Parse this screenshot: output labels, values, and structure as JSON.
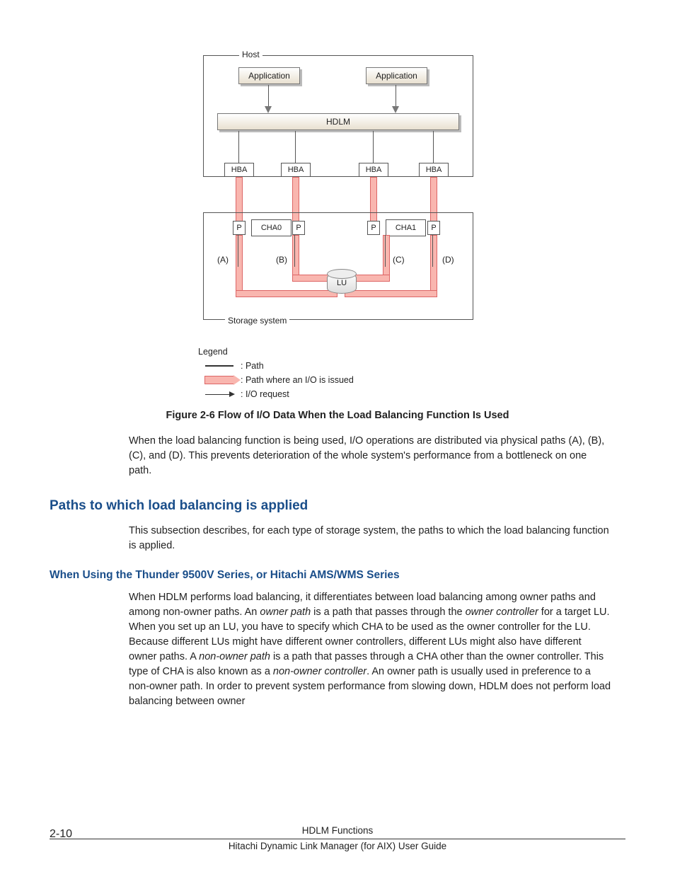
{
  "diagram": {
    "host_label": "Host",
    "app1": "Application",
    "app2": "Application",
    "hdlm": "HDLM",
    "hba": "HBA",
    "storage_label": "Storage system",
    "p": "P",
    "cha0": "CHA0",
    "cha1": "CHA1",
    "lu": "LU",
    "letters": {
      "a": "(A)",
      "b": "(B)",
      "c": "(C)",
      "d": "(D)"
    }
  },
  "legend": {
    "title": "Legend",
    "path": ": Path",
    "pink": ": Path where an I/O is issued",
    "arrow": ": I/O request"
  },
  "caption": "Figure 2-6 Flow of I/O Data When the Load Balancing Function Is Used",
  "para1": "When the load balancing function is being used, I/O operations are distributed via physical paths (A), (B), (C), and (D). This prevents deterioration of the whole system's performance from a bottleneck on one path.",
  "h2": "Paths to which load balancing is applied",
  "para2": "This subsection describes, for each type of storage system, the paths to which the load balancing function is applied.",
  "h3": "When Using the Thunder 9500V Series, or Hitachi AMS/WMS Series",
  "para3_parts": {
    "t1": "When HDLM performs load balancing, it differentiates between load balancing among owner paths and among non-owner paths. An ",
    "e1": "owner path",
    "t2": " is a path that passes through the ",
    "e2": "owner controller",
    "t3": " for a target LU. When you set up an LU, you have to specify which CHA to be used as the owner controller for the LU. Because different LUs might have different owner controllers, different LUs might also have different owner paths. A ",
    "e3": "non-owner path",
    "t4": " is a path that passes through a CHA other than the owner controller. This type of CHA is also known as a ",
    "e4": "non-owner controller",
    "t5": ". An owner path is usually used in preference to a non-owner path. In order to prevent system performance from slowing down, HDLM does not perform load balancing between owner"
  },
  "footer": {
    "page": "2-10",
    "line1": "HDLM Functions",
    "line2": "Hitachi Dynamic Link Manager (for AIX) User Guide"
  }
}
